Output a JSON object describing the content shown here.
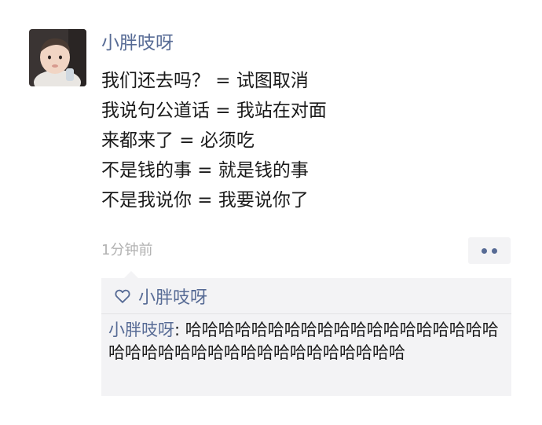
{
  "post": {
    "username": "小胖吱呀",
    "lines": [
      "我们还去吗？ = 试图取消",
      "我说句公道话 = 我站在对面",
      "来都来了 = 必须吃",
      "不是钱的事 = 就是钱的事",
      "不是我说你 = 我要说你了"
    ],
    "timestamp": "1分钟前"
  },
  "likes": {
    "names": "小胖吱呀"
  },
  "comments": [
    {
      "author": "小胖吱呀",
      "separator": ": ",
      "text": "哈哈哈哈哈哈哈哈哈哈哈哈哈哈哈哈哈哈哈哈哈哈哈哈哈哈哈哈哈哈哈哈哈哈哈哈哈"
    }
  ],
  "colors": {
    "link": "#576b95",
    "timestamp": "#b2b2b2",
    "panel_background": "#f3f3f5"
  },
  "icons": {
    "avatar": "avatar-photo",
    "like": "heart-outline-icon",
    "more": "two-dots-icon"
  }
}
